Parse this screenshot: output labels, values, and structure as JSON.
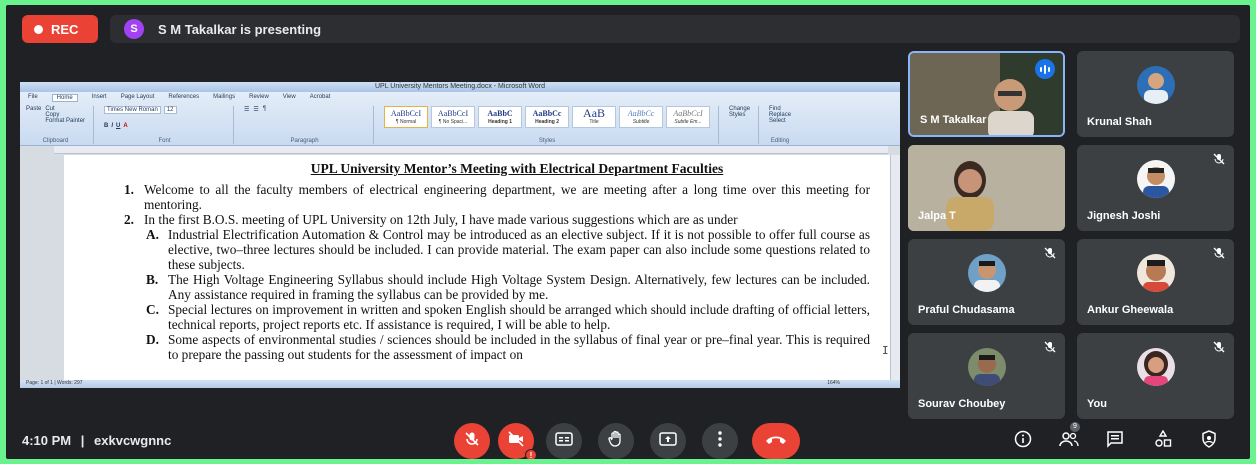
{
  "top": {
    "rec_label": "REC",
    "presenter_initial": "S",
    "presenting_text": "S M Takalkar is presenting"
  },
  "word": {
    "window_title": "UPL University Mentors Meeting.docx - Microsoft Word",
    "tabs": [
      "File",
      "Home",
      "Insert",
      "Page Layout",
      "References",
      "Mailings",
      "Review",
      "View",
      "Acrobat"
    ],
    "clipboard": {
      "paste": "Paste",
      "cut": "Cut",
      "copy": "Copy",
      "format_painter": "Format Painter",
      "group": "Clipboard"
    },
    "font": {
      "name": "Times New Roman",
      "size": "12",
      "group": "Font"
    },
    "paragraph_group": "Paragraph",
    "styles": [
      {
        "sample": "AaBbCcI",
        "label": "¶ Normal"
      },
      {
        "sample": "AaBbCcI",
        "label": "¶ No Spaci..."
      },
      {
        "sample": "AaBbC",
        "label": "Heading 1"
      },
      {
        "sample": "AaBbCc",
        "label": "Heading 2"
      },
      {
        "sample": "AaB",
        "label": "Title"
      },
      {
        "sample": "AaBbCc",
        "label": "Subtitle"
      },
      {
        "sample": "AaBbCcI",
        "label": "Subtle Em..."
      }
    ],
    "styles_group": "Styles",
    "change_styles": "Change Styles",
    "editing": {
      "find": "Find",
      "replace": "Replace",
      "select": "Select",
      "group": "Editing"
    },
    "status_left": "Page: 1 of 1 | Words: 297",
    "status_right": "164%"
  },
  "document": {
    "title": "UPL University Mentor’s Meeting with Electrical Department Faculties",
    "items": [
      {
        "num": "1.",
        "text": "Welcome to all the faculty members of electrical engineering department, we are meeting after a long time over this meeting for mentoring."
      },
      {
        "num": "2.",
        "text": "In the first B.O.S. meeting of UPL University on 12th July, I have made various suggestions which are as under"
      }
    ],
    "subitems": [
      {
        "num": "A.",
        "text": "Industrial Electrification Automation & Control may be introduced as an elective subject. If it is not possible to offer full course as elective, two–three lectures should be included. I can provide material. The exam paper can also include some questions related to these subjects."
      },
      {
        "num": "B.",
        "text": "The High Voltage Engineering Syllabus should include High Voltage System Design. Alternatively, few lectures can be included. Any assistance required in framing the syllabus can be provided by me."
      },
      {
        "num": "C.",
        "text": "Special lectures on improvement in written and spoken English should be arranged which should include drafting of official letters, technical reports, project reports etc. If assistance is required, I will be able to help."
      },
      {
        "num": "D.",
        "text": "Some aspects of environmental studies / sciences should be included in the syllabus of final year or pre–final year. This is required to prepare the passing out students for the assessment of impact on"
      }
    ]
  },
  "participants": [
    {
      "name": "S M Takalkar",
      "muted": false
    },
    {
      "name": "Krunal Shah",
      "muted": false
    },
    {
      "name": "Jalpa T",
      "muted": false
    },
    {
      "name": "Jignesh Joshi",
      "muted": true
    },
    {
      "name": "Praful Chudasama",
      "muted": true
    },
    {
      "name": "Ankur Gheewala",
      "muted": true
    },
    {
      "name": "Sourav Choubey",
      "muted": true
    },
    {
      "name": "You",
      "muted": true
    }
  ],
  "bottom": {
    "time": "4:10 PM",
    "separator": "|",
    "meeting_code": "exkvcwgnnc",
    "camera_alert": "!",
    "people_count": "9"
  },
  "colors": {
    "background_green": "#69f28d",
    "meet_dark": "#202124",
    "tile": "#3c4043",
    "red": "#ea4335",
    "accent_blue": "#1a73e8"
  },
  "icons": [
    "mic-off-icon",
    "camera-off-icon",
    "captions-icon",
    "raise-hand-icon",
    "present-icon",
    "more-options-icon",
    "end-call-icon",
    "info-icon",
    "people-icon",
    "chat-icon",
    "activities-icon",
    "host-controls-icon"
  ]
}
